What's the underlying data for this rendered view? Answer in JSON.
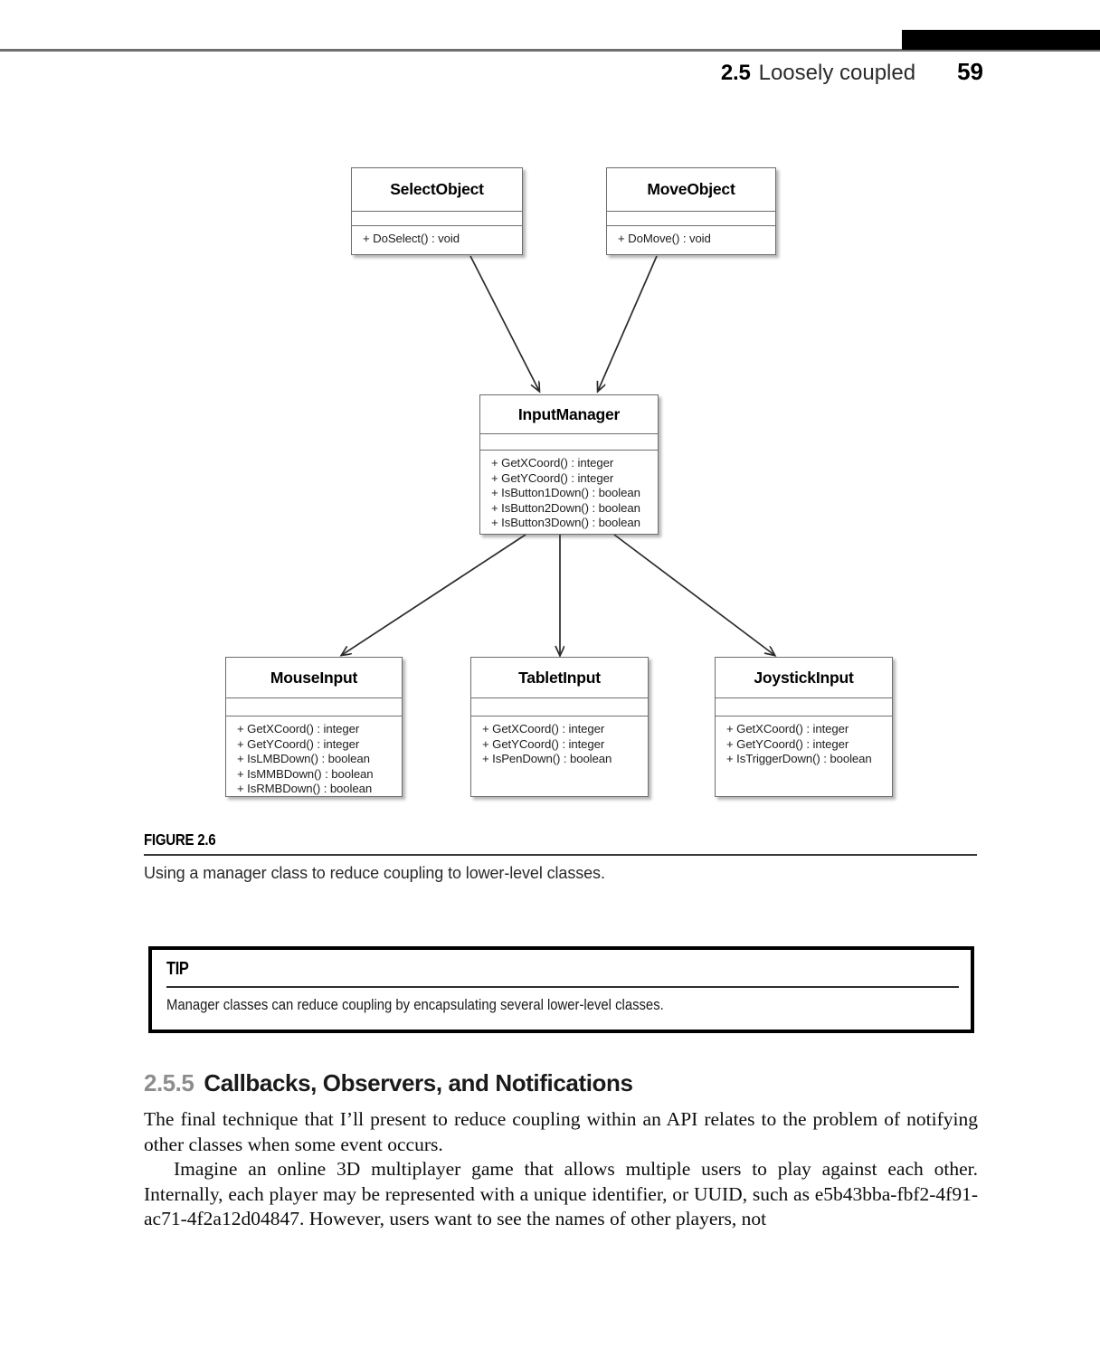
{
  "header": {
    "section_number": "2.5",
    "section_title": "Loosely coupled",
    "page_number": "59"
  },
  "figure": {
    "label": "FIGURE 2.6",
    "caption": "Using a manager class to reduce coupling to lower-level classes.",
    "classes": [
      {
        "id": "select-object",
        "name": "SelectObject",
        "operations": [
          "+ DoSelect() : void"
        ]
      },
      {
        "id": "move-object",
        "name": "MoveObject",
        "operations": [
          "+ DoMove() : void"
        ]
      },
      {
        "id": "input-manager",
        "name": "InputManager",
        "operations": [
          "+ GetXCoord() : integer",
          "+ GetYCoord() : integer",
          "+ IsButton1Down() : boolean",
          "+ IsButton2Down() : boolean",
          "+ IsButton3Down() : boolean"
        ]
      },
      {
        "id": "mouse-input",
        "name": "MouseInput",
        "operations": [
          "+ GetXCoord() : integer",
          "+ GetYCoord() : integer",
          "+ IsLMBDown() : boolean",
          "+ IsMMBDown() : boolean",
          "+ IsRMBDown() : boolean"
        ]
      },
      {
        "id": "tablet-input",
        "name": "TabletInput",
        "operations": [
          "+ GetXCoord() : integer",
          "+ GetYCoord() : integer",
          "+ IsPenDown() : boolean"
        ]
      },
      {
        "id": "joystick-input",
        "name": "JoystickInput",
        "operations": [
          "+ GetXCoord() : integer",
          "+ GetYCoord() : integer",
          "+ IsTriggerDown() : boolean"
        ]
      }
    ],
    "connections": [
      {
        "from": "SelectObject",
        "to": "InputManager"
      },
      {
        "from": "MoveObject",
        "to": "InputManager"
      },
      {
        "from": "InputManager",
        "to": "MouseInput"
      },
      {
        "from": "InputManager",
        "to": "TabletInput"
      },
      {
        "from": "InputManager",
        "to": "JoystickInput"
      }
    ]
  },
  "tip": {
    "heading": "TIP",
    "text": "Manager classes can reduce coupling by encapsulating several lower-level classes."
  },
  "section": {
    "number": "2.5.5",
    "title": "Callbacks, Observers, and Notifications"
  },
  "body": {
    "paragraph_1": "The final technique that I’ll present to reduce coupling within an API relates to the problem of notifying other classes when some event occurs.",
    "paragraph_2": "Imagine an online 3D multiplayer game that allows multiple users to play against each other. Internally, each player may be represented with a unique identifier, or UUID, such as e5b43bba-fbf2-4f91-ac71-4f2a12d04847. However, users want to see the names of other players, not"
  },
  "colors": {
    "rule_gray": "#6e6e6e",
    "black_bar": "#000000",
    "section_number_gray": "#8d8d8d",
    "box_border": "#6d6d6d"
  }
}
